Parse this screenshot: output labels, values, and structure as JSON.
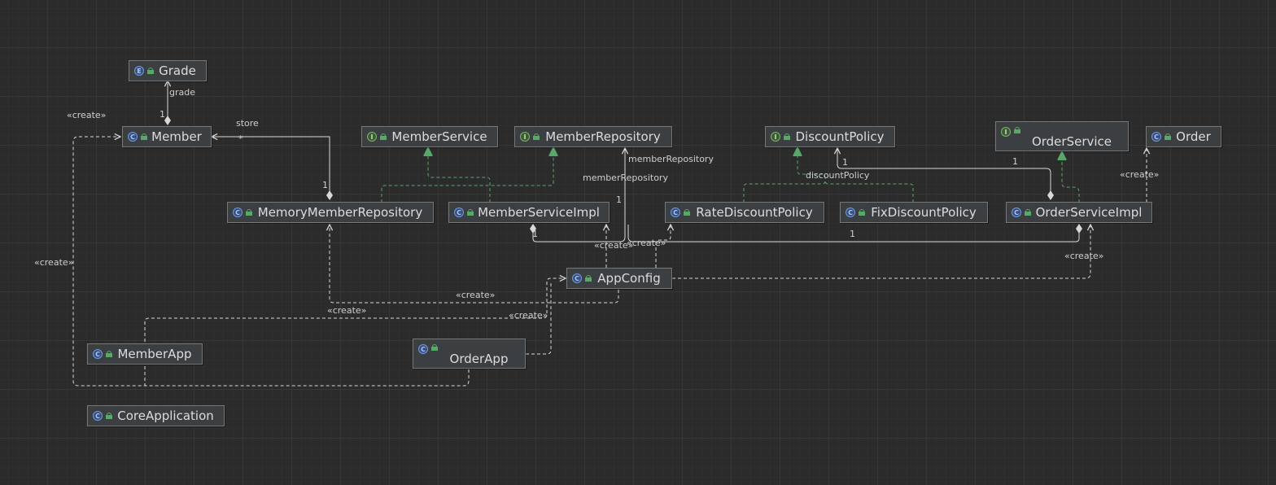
{
  "colors": {
    "background": "#2b2b2b",
    "node_fill": "#3c3f41",
    "node_border": "#777777",
    "edge_solid": "#d8d8d8",
    "edge_dashed": "#d8d8d8",
    "edge_realization": "#59a869",
    "text": "#dcdcdc"
  },
  "nodes": [
    {
      "id": "grade",
      "label": "Grade",
      "kind": "enum",
      "icon": "enum-icon"
    },
    {
      "id": "member",
      "label": "Member",
      "kind": "class",
      "icon": "class-icon"
    },
    {
      "id": "member_service",
      "label": "MemberService",
      "kind": "interface",
      "icon": "interface-icon"
    },
    {
      "id": "member_repository",
      "label": "MemberRepository",
      "kind": "interface",
      "icon": "interface-icon"
    },
    {
      "id": "discount_policy",
      "label": "DiscountPolicy",
      "kind": "interface",
      "icon": "interface-icon"
    },
    {
      "id": "order_service",
      "label": "OrderService",
      "kind": "interface",
      "icon": "interface-icon"
    },
    {
      "id": "order",
      "label": "Order",
      "kind": "class",
      "icon": "class-icon"
    },
    {
      "id": "memory_member_repository",
      "label": "MemoryMemberRepository",
      "kind": "class",
      "icon": "class-icon"
    },
    {
      "id": "member_service_impl",
      "label": "MemberServiceImpl",
      "kind": "class",
      "icon": "class-icon"
    },
    {
      "id": "rate_discount_policy",
      "label": "RateDiscountPolicy",
      "kind": "class",
      "icon": "class-icon"
    },
    {
      "id": "fix_discount_policy",
      "label": "FixDiscountPolicy",
      "kind": "class",
      "icon": "class-icon"
    },
    {
      "id": "order_service_impl",
      "label": "OrderServiceImpl",
      "kind": "class",
      "icon": "class-icon"
    },
    {
      "id": "app_config",
      "label": "AppConfig",
      "kind": "class",
      "icon": "class-icon"
    },
    {
      "id": "member_app",
      "label": "MemberApp",
      "kind": "class",
      "icon": "class-icon"
    },
    {
      "id": "order_app",
      "label": "OrderApp",
      "kind": "class",
      "icon": "class-icon"
    },
    {
      "id": "core_application",
      "label": "CoreApplication",
      "kind": "class",
      "icon": "spring-class-icon"
    }
  ],
  "edge_labels": {
    "create_member_top": "«create»",
    "grade_role": "grade",
    "grade_mult": "1",
    "store_role": "store",
    "store_mult_star": "*",
    "store_mult_one": "1",
    "member_repository_role_1": "memberRepository",
    "member_repository_role_2": "memberRepository",
    "member_repository_mult": "1",
    "discount_policy_role": "discountPolicy",
    "discount_policy_mult_top": "1",
    "discount_policy_mult_right": "1",
    "member_service_impl_mult": "1",
    "order_service_impl_mult": "1",
    "create_order": "«create»",
    "create_left": "«create»",
    "create_appconfig_1": "«create»",
    "create_appconfig_2": "«create»",
    "create_order_service_impl": "«create»",
    "create_memory_repo": "«create»",
    "create_member_app": "«create»",
    "create_order_app": "«create»"
  }
}
